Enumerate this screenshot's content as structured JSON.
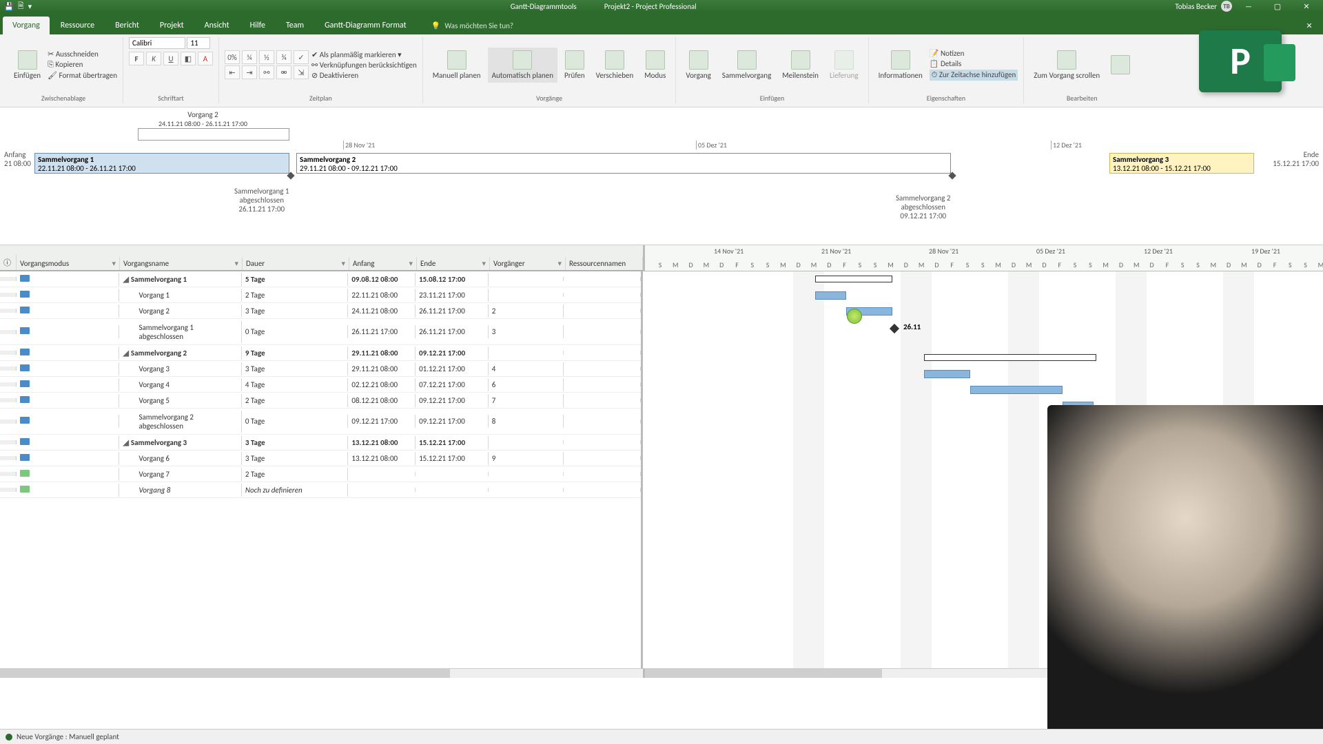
{
  "titlebar": {
    "tools": "Gantt-Diagrammtools",
    "doc": "Projekt2 - Project Professional",
    "user": "Tobias Becker",
    "initials": "TB"
  },
  "tabs": {
    "vorgang": "Vorgang",
    "ressource": "Ressource",
    "bericht": "Bericht",
    "projekt": "Projekt",
    "ansicht": "Ansicht",
    "hilfe": "Hilfe",
    "team": "Team",
    "format": "Gantt-Diagramm Format",
    "tell": "Was möchten Sie tun?"
  },
  "ribbon": {
    "clipboard": {
      "einfuegen": "Einfügen",
      "ausschneiden": "Ausschneiden",
      "kopieren": "Kopieren",
      "format": "Format übertragen",
      "group": "Zwischenablage"
    },
    "font": {
      "name": "Calibri",
      "size": "11",
      "group": "Schriftart"
    },
    "schedule": {
      "planmaessig": "Als planmäßig markieren",
      "verknuepfung": "Verknüpfungen berücksichtigen",
      "deaktivieren": "Deaktivieren",
      "group": "Zeitplan"
    },
    "tasks": {
      "manuell": "Manuell planen",
      "auto": "Automatisch planen",
      "pruefen": "Prüfen",
      "verschieben": "Verschieben",
      "modus": "Modus",
      "group": "Vorgänge"
    },
    "insert": {
      "vorgang": "Vorgang",
      "sammelvorgang": "Sammelvorgang",
      "meilenstein": "Meilenstein",
      "lieferung": "Lieferung",
      "group": "Einfügen"
    },
    "properties": {
      "info": "Informationen",
      "notizen": "Notizen",
      "details": "Details",
      "zeitachse": "Zur Zeitachse hinzufügen",
      "group": "Eigenschaften"
    },
    "edit": {
      "zumvorgang": "Zum Vorgang scrollen",
      "group": "Bearbeiten"
    }
  },
  "timeline": {
    "v2_label": "Vorgang 2",
    "v2_range": "24.11.21 08:00 - 26.11.21 17:00",
    "anfang_label": "Anfang",
    "anfang_date": "21 08:00",
    "ende_label": "Ende",
    "ende_date": "15.12.21 17:00",
    "tick1": "28 Nov '21",
    "tick2": "05 Dez '21",
    "tick3": "12 Dez '21",
    "sv1_name": "Sammelvorgang 1",
    "sv1_range": "22.11.21 08:00 - 26.11.21 17:00",
    "sv2_name": "Sammelvorgang 2",
    "sv2_range": "29.11.21 08:00 - 09.12.21 17:00",
    "sv3_name": "Sammelvorgang 3",
    "sv3_range": "13.12.21 08:00 - 15.12.21 17:00",
    "ms1_l1": "Sammelvorgang 1",
    "ms1_l2": "abgeschlossen",
    "ms1_l3": "26.11.21 17:00",
    "ms2_l1": "Sammelvorgang 2",
    "ms2_l2": "abgeschlossen",
    "ms2_l3": "09.12.21 17:00"
  },
  "columns": {
    "i": "i",
    "mode": "Vorgangsmodus",
    "name": "Vorgangsname",
    "dur": "Dauer",
    "start": "Anfang",
    "end": "Ende",
    "pred": "Vorgänger",
    "res": "Ressourcennamen"
  },
  "gantt_months": {
    "m1": "14 Nov '21",
    "m2": "21 Nov '21",
    "m3": "28 Nov '21",
    "m4": "05 Dez '21",
    "m5": "12 Dez '21",
    "m6": "19 Dez '21"
  },
  "gantt_days": [
    "M",
    "D",
    "F",
    "S",
    "S",
    "M",
    "D",
    "M",
    "D",
    "F",
    "S",
    "S",
    "M",
    "D",
    "M",
    "D",
    "F",
    "S",
    "S",
    "M",
    "D",
    "M",
    "D",
    "F",
    "S",
    "S",
    "M",
    "D"
  ],
  "rows": [
    {
      "summary": true,
      "name": "Sammelvorgang 1",
      "dur": "5 Tage",
      "start": "09.08.12 08:00",
      "end": "15.08.12 17:00",
      "pred": ""
    },
    {
      "summary": false,
      "name": "Vorgang 1",
      "dur": "2 Tage",
      "start": "22.11.21 08:00",
      "end": "23.11.21 17:00",
      "pred": ""
    },
    {
      "summary": false,
      "name": "Vorgang 2",
      "dur": "3 Tage",
      "start": "24.11.21 08:00",
      "end": "26.11.21 17:00",
      "pred": "2"
    },
    {
      "summary": false,
      "name": "Sammelvorgang 1 abgeschlossen",
      "dur": "0 Tage",
      "start": "26.11.21 17:00",
      "end": "26.11.21 17:00",
      "pred": "3",
      "tall": true
    },
    {
      "summary": true,
      "name": "Sammelvorgang 2",
      "dur": "9 Tage",
      "start": "29.11.21 08:00",
      "end": "09.12.21 17:00",
      "pred": ""
    },
    {
      "summary": false,
      "name": "Vorgang 3",
      "dur": "3 Tage",
      "start": "29.11.21 08:00",
      "end": "01.12.21 17:00",
      "pred": "4"
    },
    {
      "summary": false,
      "name": "Vorgang 4",
      "dur": "4 Tage",
      "start": "02.12.21 08:00",
      "end": "07.12.21 17:00",
      "pred": "6"
    },
    {
      "summary": false,
      "name": "Vorgang 5",
      "dur": "2 Tage",
      "start": "08.12.21 08:00",
      "end": "09.12.21 17:00",
      "pred": "7"
    },
    {
      "summary": false,
      "name": "Sammelvorgang 2 abgeschlossen",
      "dur": "0 Tage",
      "start": "09.12.21 17:00",
      "end": "09.12.21 17:00",
      "pred": "8",
      "tall": true
    },
    {
      "summary": true,
      "name": "Sammelvorgang 3",
      "dur": "3 Tage",
      "start": "13.12.21 08:00",
      "end": "15.12.21 17:00",
      "pred": ""
    },
    {
      "summary": false,
      "name": "Vorgang 6",
      "dur": "3 Tage",
      "start": "13.12.21 08:00",
      "end": "15.12.21 17:00",
      "pred": "9"
    },
    {
      "summary": false,
      "name": "Vorgang 7",
      "dur": "2 Tage",
      "start": "",
      "end": "",
      "pred": "",
      "manual": true
    },
    {
      "summary": false,
      "name": "Vorgang 8",
      "dur": "Noch zu definieren",
      "start": "",
      "end": "",
      "pred": "",
      "placeholder": true,
      "manual": true
    }
  ],
  "gantt_ms_label": "26.11",
  "status": "Neue Vorgänge : Manuell geplant",
  "logo_letter": "P"
}
